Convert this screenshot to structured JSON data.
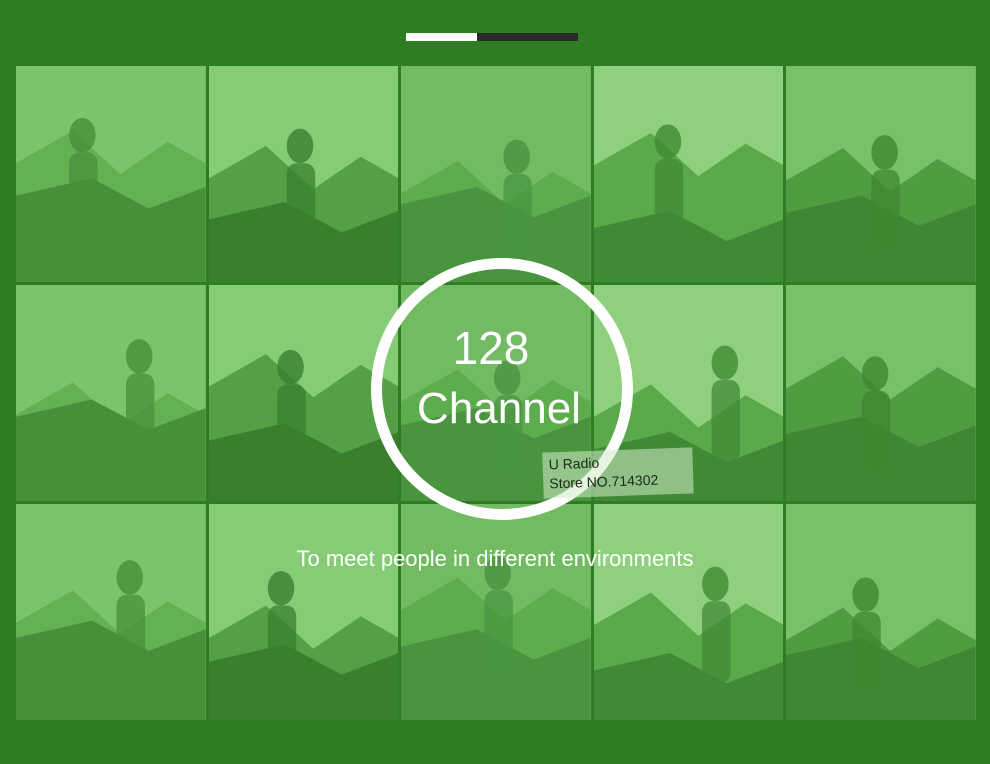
{
  "progress": {
    "value": 0.41,
    "track_color": "#2a2a2a",
    "fill_color": "#ffffff"
  },
  "colors": {
    "background": "#2f7d22",
    "tile_tint": "#5fae4f",
    "text": "#ffffff"
  },
  "photo_grid": {
    "tiles": [
      {
        "name": "hikers-mountain-photo"
      },
      {
        "name": "campers-tent-photo"
      },
      {
        "name": "family-car-trunk-photo"
      },
      {
        "name": "worker-walkie-talkie-photo"
      },
      {
        "name": "engineer-hardhat-photo"
      },
      {
        "name": "woman-backpack-photo"
      },
      {
        "name": "trekker-poles-photo"
      },
      {
        "name": "trekkers-center-photo"
      },
      {
        "name": "smiling-couple-photo"
      },
      {
        "name": "hiking-group-photo"
      },
      {
        "name": "engineers-tablet-photo"
      },
      {
        "name": "friends-phone-photo"
      },
      {
        "name": "suv-photo"
      },
      {
        "name": "hiker-hill-photo"
      },
      {
        "name": "mountaineer-photo"
      }
    ]
  },
  "badge": {
    "number": "128",
    "label": "Channel"
  },
  "watermark": {
    "line1": "U Radio",
    "line2": "Store NO.714302"
  },
  "caption": "To meet people in different environments"
}
